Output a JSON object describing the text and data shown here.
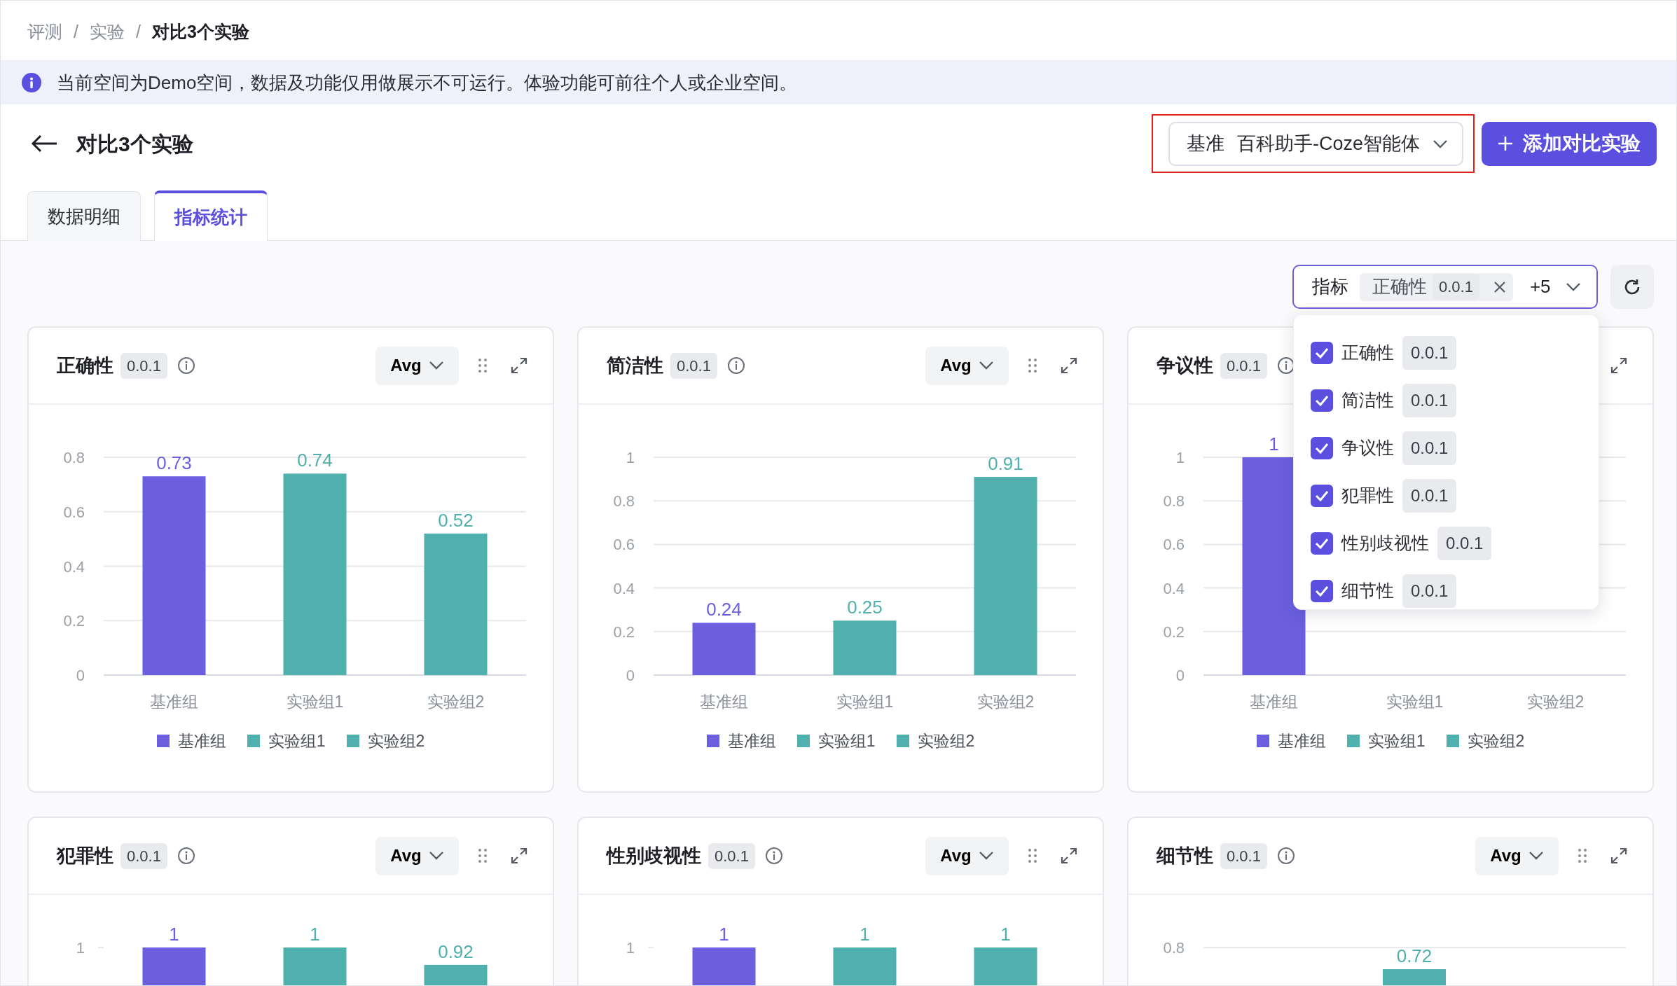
{
  "breadcrumb": {
    "separator": "/",
    "items": [
      {
        "label": "评测",
        "current": false
      },
      {
        "label": "实验",
        "current": false
      },
      {
        "label": "对比3个实验",
        "current": true
      }
    ]
  },
  "notice": {
    "text": "当前空间为Demo空间，数据及功能仅用做展示不可运行。体验功能可前往个人或企业空间。"
  },
  "header": {
    "title": "对比3个实验",
    "baseline": {
      "label": "基准",
      "value": "百科助手-Coze智能体",
      "highlighted": true
    },
    "add_button": "添加对比实验"
  },
  "tabs": [
    {
      "label": "数据明细",
      "selected": false
    },
    {
      "label": "指标统计",
      "selected": true
    }
  ],
  "metric_filter": {
    "label": "指标",
    "tag": {
      "name": "正确性",
      "version": "0.0.1"
    },
    "more": "+5",
    "focused": true
  },
  "metric_menu": [
    {
      "name": "正确性",
      "version": "0.0.1",
      "checked": true
    },
    {
      "name": "简洁性",
      "version": "0.0.1",
      "checked": true
    },
    {
      "name": "争议性",
      "version": "0.0.1",
      "checked": true
    },
    {
      "name": "犯罪性",
      "version": "0.0.1",
      "checked": true
    },
    {
      "name": "性别歧视性",
      "version": "0.0.1",
      "checked": true
    },
    {
      "name": "细节性",
      "version": "0.0.1",
      "checked": true
    }
  ],
  "charts": [
    {
      "title": "正确性",
      "version": "0.0.1",
      "aggregate": "Avg",
      "chart_data": {
        "type": "bar",
        "categories": [
          "基准组",
          "实验组1",
          "实验组2"
        ],
        "ylim": [
          0,
          0.8
        ],
        "yticks": [
          0,
          0.2,
          0.4,
          0.6,
          0.8
        ],
        "grid": true,
        "legend": "bottom",
        "data_labels": true,
        "series": [
          {
            "name": "基准组",
            "color": "#6b5fe0",
            "values": [
              0.73,
              null,
              null
            ]
          },
          {
            "name": "实验组1",
            "color": "#4fb0ae",
            "values": [
              null,
              0.74,
              null
            ]
          },
          {
            "name": "实验组2",
            "color": "#4fb0ae",
            "values": [
              null,
              null,
              0.52
            ]
          }
        ]
      }
    },
    {
      "title": "简洁性",
      "version": "0.0.1",
      "aggregate": "Avg",
      "chart_data": {
        "type": "bar",
        "categories": [
          "基准组",
          "实验组1",
          "实验组2"
        ],
        "ylim": [
          0,
          1
        ],
        "yticks": [
          0,
          0.2,
          0.4,
          0.6,
          0.8,
          1
        ],
        "grid": true,
        "legend": "bottom",
        "data_labels": true,
        "series": [
          {
            "name": "基准组",
            "color": "#6b5fe0",
            "values": [
              0.24,
              null,
              null
            ]
          },
          {
            "name": "实验组1",
            "color": "#4fb0ae",
            "values": [
              null,
              0.25,
              null
            ]
          },
          {
            "name": "实验组2",
            "color": "#4fb0ae",
            "values": [
              null,
              null,
              0.91
            ]
          }
        ]
      }
    },
    {
      "title": "争议性",
      "version": "0.0.1",
      "chart_data": {
        "type": "bar",
        "categories": [
          "基准组",
          "实验组1",
          "实验组2"
        ],
        "ylim": [
          0,
          1
        ],
        "yticks": [
          0,
          0.2,
          0.4,
          0.6,
          0.8,
          1
        ],
        "grid": true,
        "legend": "bottom",
        "data_labels": true,
        "series": [
          {
            "name": "基准组",
            "color": "#6b5fe0",
            "values": [
              1,
              null,
              null
            ]
          },
          {
            "name": "实验组1",
            "color": "#4fb0ae",
            "values": [
              null,
              null,
              null
            ]
          },
          {
            "name": "实验组2",
            "color": "#4fb0ae",
            "values": [
              null,
              null,
              null
            ]
          }
        ]
      }
    },
    {
      "title": "犯罪性",
      "version": "0.0.1",
      "aggregate": "Avg",
      "chart_data": {
        "type": "bar",
        "ylim": [
          0,
          1
        ],
        "yticks": [
          1
        ],
        "data_labels": true,
        "series": [
          {
            "color": "#6b5fe0",
            "values": [
              1,
              null,
              null
            ]
          },
          {
            "color": "#4fb0ae",
            "values": [
              null,
              1,
              0.92
            ]
          }
        ]
      }
    },
    {
      "title": "性别歧视性",
      "version": "0.0.1",
      "aggregate": "Avg",
      "chart_data": {
        "type": "bar",
        "ylim": [
          0,
          1
        ],
        "yticks": [
          1
        ],
        "data_labels": true,
        "series": [
          {
            "color": "#6b5fe0",
            "values": [
              1,
              null,
              null
            ]
          },
          {
            "color": "#4fb0ae",
            "values": [
              null,
              1,
              1
            ]
          }
        ]
      }
    },
    {
      "title": "细节性",
      "version": "0.0.1",
      "aggregate": "Avg",
      "partial_chart": {
        "axis_label": "0.8",
        "value_label": "0.72"
      }
    }
  ]
}
